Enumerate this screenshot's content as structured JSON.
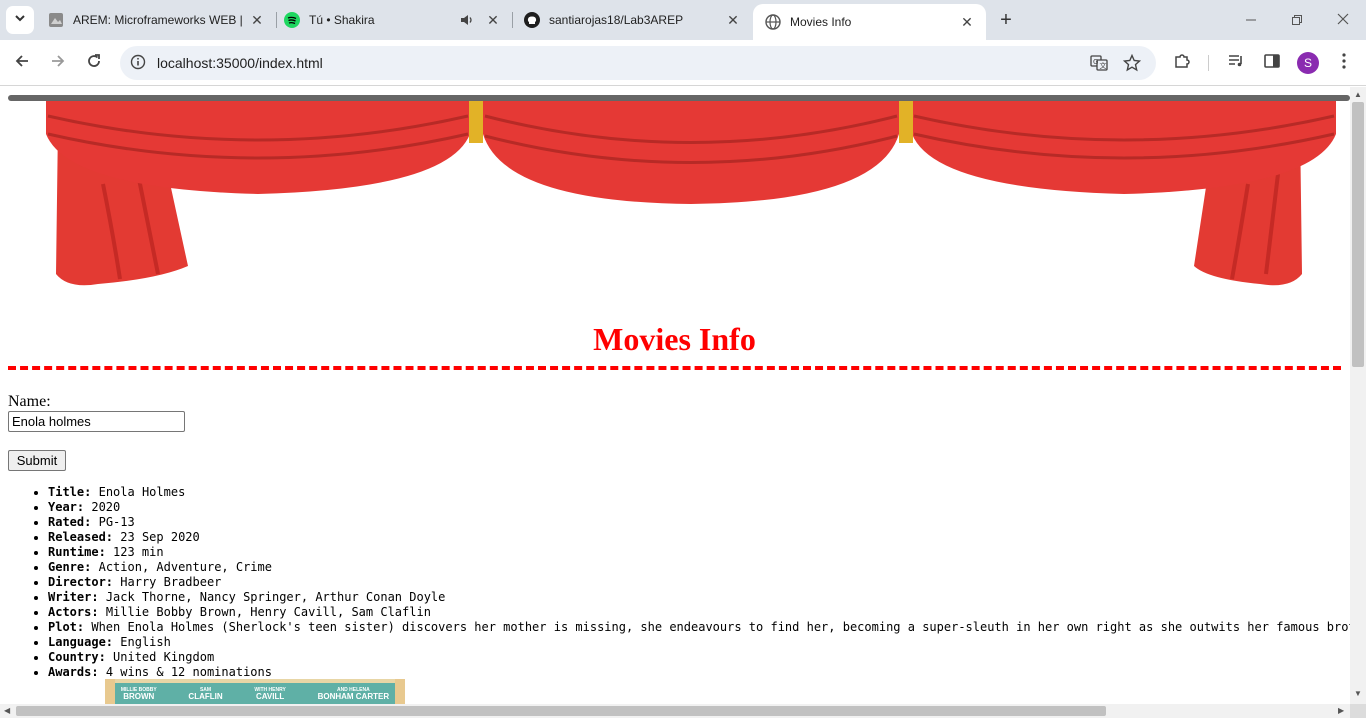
{
  "browser": {
    "tabs": [
      {
        "title": "AREM: Microframeworks WEB |",
        "icon": "page-icon"
      },
      {
        "title": "Tú • Shakira",
        "icon": "spotify-icon"
      },
      {
        "title": "santiarojas18/Lab3AREP",
        "icon": "github-icon"
      },
      {
        "title": "Movies Info",
        "icon": "globe-icon"
      }
    ],
    "url": "localhost:35000/index.html",
    "profile_initial": "S"
  },
  "page": {
    "heading": "Movies Info",
    "accent_color": "#ff0000",
    "form": {
      "name_label": "Name:",
      "name_value": "Enola holmes",
      "submit_label": "Submit"
    },
    "movie": [
      {
        "label": "Title:",
        "value": "Enola Holmes"
      },
      {
        "label": "Year:",
        "value": "2020"
      },
      {
        "label": "Rated:",
        "value": "PG-13"
      },
      {
        "label": "Released:",
        "value": "23 Sep 2020"
      },
      {
        "label": "Runtime:",
        "value": "123 min"
      },
      {
        "label": "Genre:",
        "value": "Action, Adventure, Crime"
      },
      {
        "label": "Director:",
        "value": "Harry Bradbeer"
      },
      {
        "label": "Writer:",
        "value": "Jack Thorne, Nancy Springer, Arthur Conan Doyle"
      },
      {
        "label": "Actors:",
        "value": "Millie Bobby Brown, Henry Cavill, Sam Claflin"
      },
      {
        "label": "Plot:",
        "value": "When Enola Holmes (Sherlock's teen sister) discovers her mother is missing, she endeavours to find her, becoming a super-sleuth in her own right as she outwits her famous broth"
      },
      {
        "label": "Language:",
        "value": "English"
      },
      {
        "label": "Country:",
        "value": "United Kingdom"
      },
      {
        "label": "Awards:",
        "value": "4 wins & 12 nominations"
      }
    ],
    "poster_credits": [
      {
        "top": "MILLIE BOBBY",
        "name": "BROWN"
      },
      {
        "top": "SAM",
        "name": "CLAFLIN"
      },
      {
        "top": "WITH HENRY",
        "name": "CAVILL"
      },
      {
        "top": "AND HELENA",
        "name": "BONHAM CARTER"
      }
    ]
  }
}
